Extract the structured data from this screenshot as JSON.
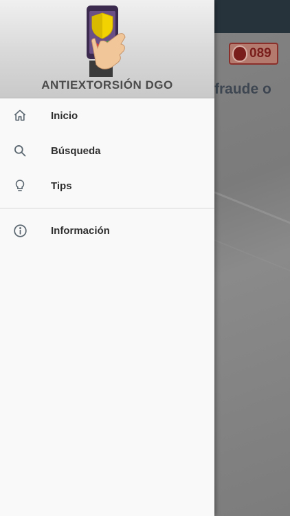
{
  "app": {
    "name": "ANTIEXTORSIÓN DGO"
  },
  "background": {
    "heading_fragment": "fraude o",
    "badge_text": "089"
  },
  "menu": {
    "items": [
      {
        "label": "Inicio",
        "icon": "home-icon"
      },
      {
        "label": "Búsqueda",
        "icon": "search-icon"
      },
      {
        "label": "Tips",
        "icon": "lightbulb-icon"
      },
      {
        "label": "Información",
        "icon": "info-icon"
      }
    ]
  },
  "colors": {
    "topbar": "#27333b",
    "drawer_bg": "#f9f9f9",
    "icon": "#5b6770",
    "text": "#2f2f2f",
    "badge": "#8b2f2a"
  }
}
